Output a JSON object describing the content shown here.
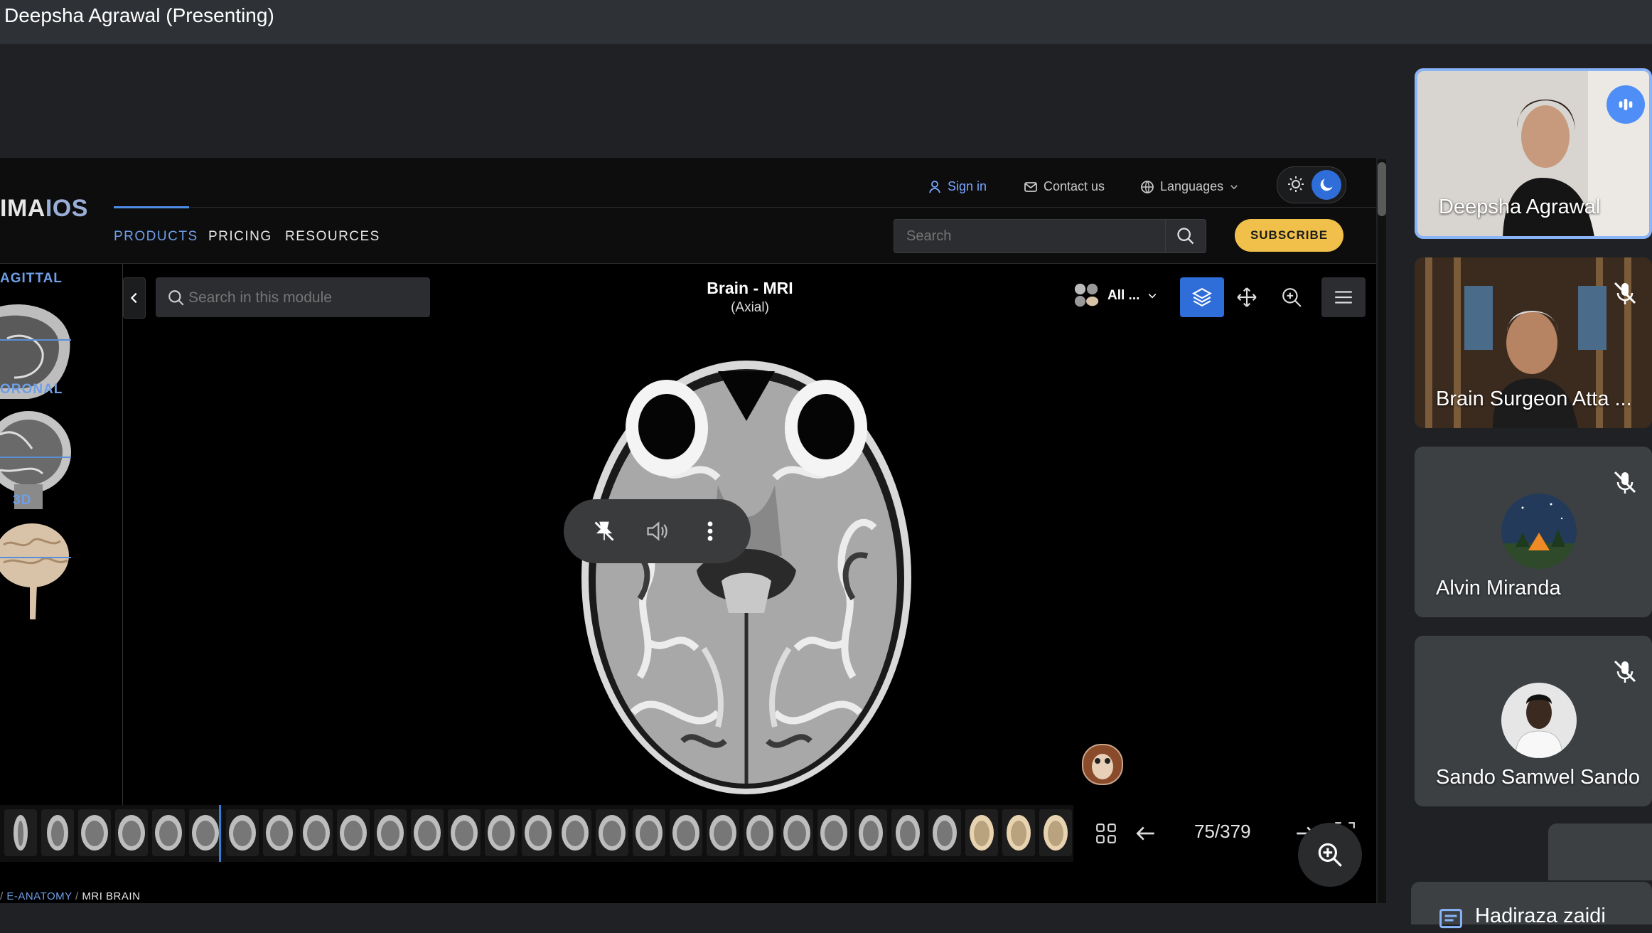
{
  "meet": {
    "presenter_title": "Deepsha Agrawal (Presenting)",
    "participants": [
      {
        "name": "Deepsha Agrawal",
        "speaking": true,
        "muted": false
      },
      {
        "name": "Brain Surgeon Atta ...",
        "speaking": false,
        "muted": true
      },
      {
        "name": "Alvin Miranda",
        "speaking": false,
        "muted": true
      },
      {
        "name": "Sando Samwel Sando",
        "speaking": false,
        "muted": true
      }
    ],
    "chat_preview_name": "Hadiraza zaidi"
  },
  "site": {
    "logo_prefix": "IMA",
    "logo_suffix": "IOS",
    "sign_in": "Sign in",
    "contact": "Contact us",
    "languages": "Languages",
    "nav": [
      "PRODUCTS",
      "PRICING",
      "RESOURCES"
    ],
    "search_placeholder": "Search",
    "subscribe": "SUBSCRIBE",
    "accent": "#6f9fe8",
    "subscribe_color": "#f0c04a"
  },
  "viewer": {
    "planes": [
      "AGITTAL",
      "ORONAL",
      "3D"
    ],
    "module_search_placeholder": "Search in this module",
    "title": "Brain - MRI",
    "subtitle": "(Axial)",
    "series_label": "All ...",
    "pager": "75/379",
    "breadcrumb": [
      "E-ANATOMY",
      "MRI BRAIN"
    ]
  }
}
